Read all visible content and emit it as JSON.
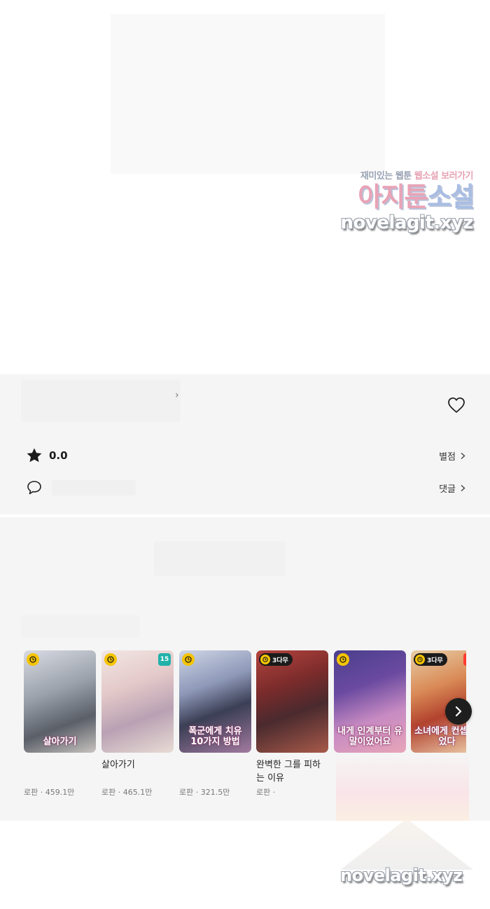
{
  "watermark": {
    "line1_a": "재미있는 웹툰",
    "line1_b": "웹소설 보러가기",
    "line2_a": "아지툰",
    "line2_b": "소설",
    "line3": "novelagit.xyz"
  },
  "info": {
    "rating_value": "0.0",
    "rating_link": "별점",
    "comments_link": "댓글"
  },
  "recommendations": {
    "items": [
      {
        "cover_text": "살아가기",
        "title": "",
        "genre": "로판",
        "views": "459.1만",
        "badge": "clock",
        "age": "",
        "up": ""
      },
      {
        "cover_text": "",
        "title": "살아가기",
        "genre": "로판",
        "views": "465.1만",
        "badge": "clock",
        "age": "15",
        "up": ""
      },
      {
        "cover_text": "폭군에게 치유 10가지 방법",
        "title": "",
        "genre": "로판",
        "views": "321.5만",
        "badge": "clock",
        "age": "",
        "up": ""
      },
      {
        "cover_text": "",
        "title": "완벽한 그를 피하는 이유",
        "genre": "로판",
        "views": "",
        "badge": "3다무",
        "age": "",
        "up": ""
      },
      {
        "cover_text": "내게 인계부터 유말이었어요",
        "title": "",
        "genre": "",
        "views": "",
        "badge": "clock",
        "age": "",
        "up": ""
      },
      {
        "cover_text": "소녀에게 컨셉 이었다",
        "title": "",
        "genre": "",
        "views": "",
        "badge": "3다무",
        "age": "",
        "up": "UP"
      }
    ]
  },
  "bottom_watermark": "novelagit.xyz",
  "colors": {
    "section_bg": "#f5f5f5",
    "clock_badge": "#f5c400",
    "age_badge": "#20b2aa",
    "up_badge": "#ff3b30"
  },
  "icons": [
    "heart-outline-icon",
    "star-icon",
    "comment-bubble-icon",
    "chevron-right-icon",
    "clock-icon"
  ]
}
